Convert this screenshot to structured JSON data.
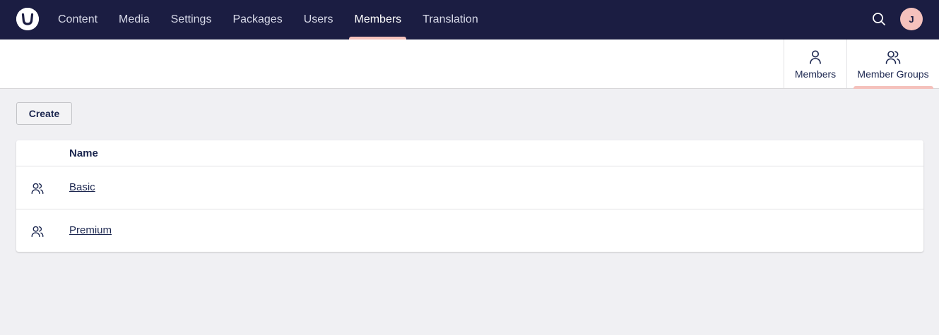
{
  "topbar": {
    "logo_icon": "umbraco-logo-icon",
    "nav": [
      {
        "label": "Content",
        "active": false
      },
      {
        "label": "Media",
        "active": false
      },
      {
        "label": "Settings",
        "active": false
      },
      {
        "label": "Packages",
        "active": false
      },
      {
        "label": "Users",
        "active": false
      },
      {
        "label": "Members",
        "active": true
      },
      {
        "label": "Translation",
        "active": false
      }
    ],
    "search_icon": "search-icon",
    "avatar_initial": "J"
  },
  "header": {
    "tabs": [
      {
        "label": "Members",
        "icon": "user-icon",
        "active": false
      },
      {
        "label": "Member Groups",
        "icon": "users-icon",
        "active": true
      }
    ]
  },
  "toolbar": {
    "create_label": "Create"
  },
  "table": {
    "columns": [
      "Name"
    ],
    "rows": [
      {
        "name": "Basic",
        "icon": "users-icon"
      },
      {
        "name": "Premium",
        "icon": "users-icon"
      }
    ]
  },
  "colors": {
    "topbar_bg": "#1b1d42",
    "accent": "#f5c1bc",
    "page_bg": "#f0f0f3",
    "text": "#1b264f"
  }
}
